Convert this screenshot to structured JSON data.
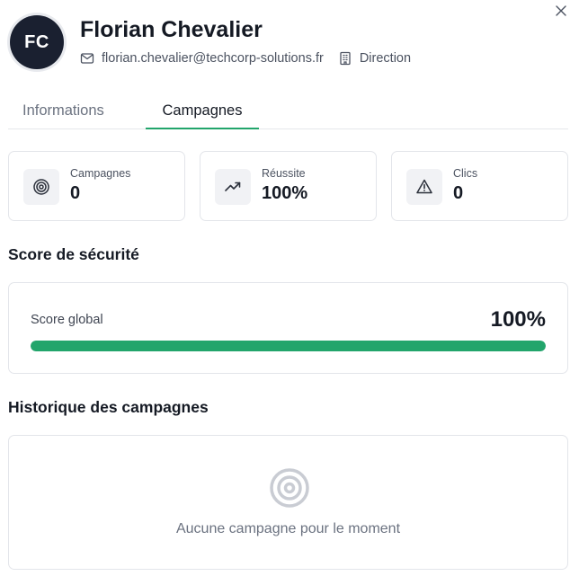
{
  "profile": {
    "initials": "FC",
    "name": "Florian Chevalier",
    "email": "florian.chevalier@techcorp-solutions.fr",
    "department": "Direction"
  },
  "tabs": [
    {
      "label": "Informations",
      "active": false
    },
    {
      "label": "Campagnes",
      "active": true
    }
  ],
  "stats": [
    {
      "label": "Campagnes",
      "value": "0",
      "icon": "target-icon"
    },
    {
      "label": "Réussite",
      "value": "100%",
      "icon": "trending-up-icon"
    },
    {
      "label": "Clics",
      "value": "0",
      "icon": "alert-triangle-icon"
    }
  ],
  "security": {
    "title": "Score de sécurité",
    "label": "Score global",
    "value": "100%",
    "progress_percent": 100,
    "bar_color": "#22a56b"
  },
  "history": {
    "title": "Historique des campagnes",
    "empty_text": "Aucune campagne pour le moment",
    "empty_icon": "target-icon"
  },
  "colors": {
    "accent": "#22a56b",
    "avatar_bg": "#1a2030"
  }
}
